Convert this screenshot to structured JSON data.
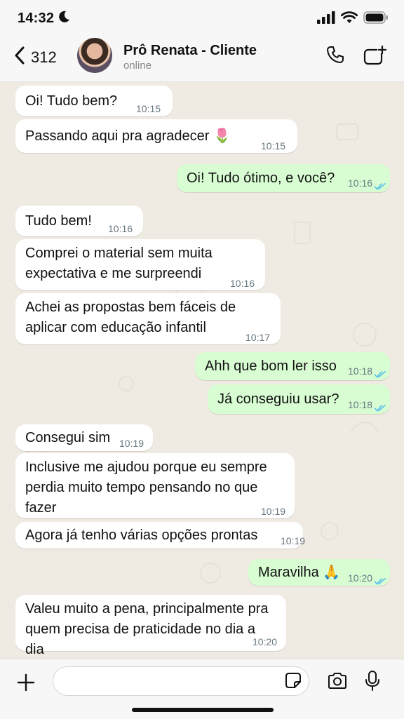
{
  "status_bar": {
    "time": "14:32"
  },
  "header": {
    "back_count": "312",
    "contact_name": "Prô Renata - Cliente",
    "contact_status": "online"
  },
  "messages": [
    {
      "dir": "in",
      "lines": [
        "Oi! Tudo bem?"
      ],
      "time": "10:15"
    },
    {
      "dir": "in",
      "lines": [
        "Passando aqui pra agradecer 🌷"
      ],
      "time": "10:15"
    },
    {
      "dir": "out",
      "lines": [
        "Oi! Tudo ótimo, e você?"
      ],
      "time": "10:16",
      "read": true
    },
    {
      "dir": "in",
      "lines": [
        "Tudo bem!"
      ],
      "time": "10:16"
    },
    {
      "dir": "in",
      "lines": [
        "Comprei o material sem muita",
        "expectativa e me surpreendi"
      ],
      "time": "10:16"
    },
    {
      "dir": "in",
      "lines": [
        "Achei as propostas bem fáceis de",
        "aplicar com educação infantil"
      ],
      "time": "10:17"
    },
    {
      "dir": "out",
      "lines": [
        "Ahh que bom ler isso"
      ],
      "time": "10:18",
      "read": true
    },
    {
      "dir": "out",
      "lines": [
        "Já conseguiu usar?"
      ],
      "time": "10:18",
      "read": true
    },
    {
      "dir": "in",
      "lines": [
        "Consegui sim"
      ],
      "time": "10:19"
    },
    {
      "dir": "in",
      "lines": [
        "Inclusive me ajudou porque eu sempre",
        "perdia muito tempo pensando no que",
        "fazer"
      ],
      "time": "10:19"
    },
    {
      "dir": "in",
      "lines": [
        "Agora já tenho várias opções prontas"
      ],
      "time": "10:19"
    },
    {
      "dir": "out",
      "lines": [
        "Maravilha 🙏"
      ],
      "time": "10:20",
      "read": true
    },
    {
      "dir": "in",
      "lines": [
        "Valeu muito  a pena, principalmente pra",
        "quem precisa de praticidade no dia a dia"
      ],
      "time": "10:20"
    }
  ],
  "colors": {
    "incoming": "#ffffff",
    "outgoing": "#d9fdd3",
    "read_ticks": "#53bdeb",
    "background": "#efeae2"
  },
  "icons": [
    "back-chevron-icon",
    "phone-icon",
    "new-chat-icon",
    "plus-icon",
    "sticker-icon",
    "camera-icon",
    "mic-icon"
  ]
}
